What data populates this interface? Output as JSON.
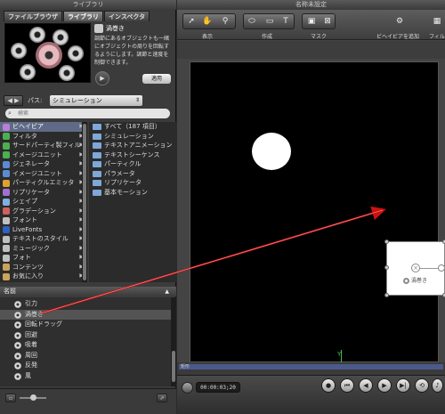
{
  "library": {
    "title": "ライブラリ",
    "tabs": [
      "ファイルブラウザ",
      "ライブラリ",
      "インスペクタ"
    ],
    "description": {
      "title": "渦巻き",
      "text": "調節にあるオブジェクトも一緒にオブジェクトの周りを回転するようにします。調節と速度を制御できます。",
      "apply_label": "適用"
    },
    "path": {
      "label": "パス:",
      "value": "シミュレーション"
    },
    "search_placeholder": "検索",
    "categories": [
      {
        "label": "ビヘイビア",
        "color": "#b87fd6",
        "selected": true
      },
      {
        "label": "フィルタ",
        "color": "#4caf50"
      },
      {
        "label": "サードパーティ製フィル",
        "color": "#4caf50"
      },
      {
        "label": "イメージユニット",
        "color": "#4caf50"
      },
      {
        "label": "ジェネレータ",
        "color": "#5b8bd1"
      },
      {
        "label": "イメージユニット",
        "color": "#5b8bd1"
      },
      {
        "label": "パーティクルエミッタ",
        "color": "#e0a030"
      },
      {
        "label": "リプリケータ",
        "color": "#a070d0"
      },
      {
        "label": "シェイプ",
        "color": "#7fb0e0"
      },
      {
        "label": "グラデーション",
        "color": "#d06060"
      },
      {
        "label": "フォント",
        "color": "#c0c0c0"
      },
      {
        "label": "LiveFonts",
        "color": "#3060c0"
      },
      {
        "label": "テキストのスタイル",
        "color": "#c0c0c0"
      },
      {
        "label": "ミュージック",
        "color": "#c0c0c0"
      },
      {
        "label": "フォト",
        "color": "#c0c0c0"
      },
      {
        "label": "コンテンツ",
        "color": "#c9a55a"
      },
      {
        "label": "お気に入り",
        "color": "#c9a55a"
      }
    ],
    "subcategories": [
      "すべて（187 項目）",
      "シミュレーション",
      "テキストアニメーション",
      "テキストシーケンス",
      "パーティクル",
      "パラメータ",
      "リプリケータ",
      "基本モーション"
    ],
    "list_header": "名前",
    "items": [
      {
        "label": "引力"
      },
      {
        "label": "渦巻き",
        "selected": true
      },
      {
        "label": "回転ドラッグ"
      },
      {
        "label": "回避"
      },
      {
        "label": "吸着"
      },
      {
        "label": "周回"
      },
      {
        "label": "反発"
      },
      {
        "label": "風"
      }
    ]
  },
  "canvas": {
    "title": "名称未設定",
    "toolbar": {
      "labels": [
        "表示",
        "作成",
        "マスク",
        "ビヘイビアを追加",
        "フィル"
      ]
    },
    "object_label": "渦巻き",
    "timeline_label": "矩形",
    "timecode": "00:00:03;20"
  },
  "colors": {
    "stage": "#000000",
    "arrow": "#cc1111",
    "selection": "#5f6b86"
  }
}
